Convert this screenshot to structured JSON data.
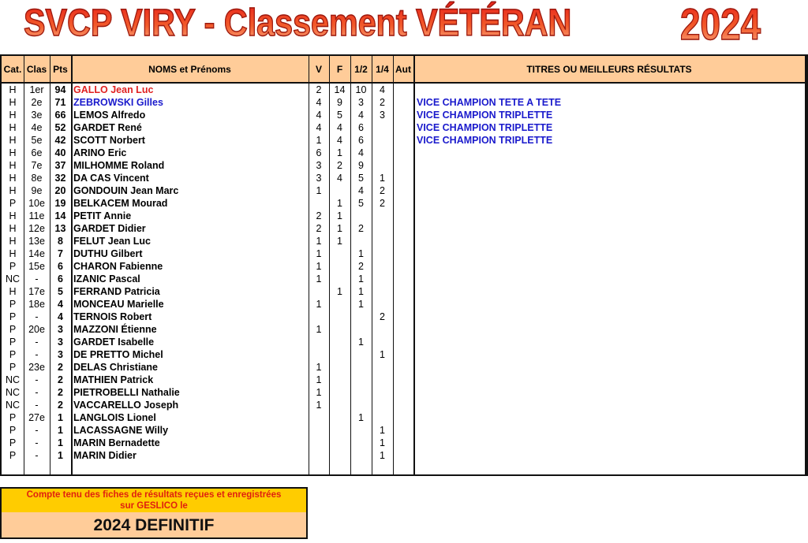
{
  "title": {
    "main": "SVCP VIRY - Classement VÉTÉRAN",
    "year": "2024"
  },
  "colors": {
    "header_bg": "#ffcc99",
    "first_name_color": "#e02020",
    "second_name_color": "#1a1acc",
    "titre_color": "#1a1acc",
    "footer_top_bg": "#ffcc00",
    "footer_text_red": "#e02010"
  },
  "table": {
    "headers": {
      "cat": "Cat.",
      "clas": "Clas",
      "pts": "Pts",
      "name": "NOMS et Prénoms",
      "v": "V",
      "f": "F",
      "half": "1/2",
      "quarter": "1/4",
      "aut": "Aut",
      "titres": "TITRES OU MEILLEURS RÉSULTATS"
    },
    "rows": [
      {
        "cat": "H",
        "clas": "1er",
        "pts": "94",
        "name": "GALLO Jean Luc",
        "v": "2",
        "f": "14",
        "half": "10",
        "quarter": "4",
        "aut": "",
        "titre": ""
      },
      {
        "cat": "H",
        "clas": "2e",
        "pts": "71",
        "name": "ZEBROWSKI Gilles",
        "v": "4",
        "f": "9",
        "half": "3",
        "quarter": "2",
        "aut": "",
        "titre": "VICE CHAMPION TETE A TETE"
      },
      {
        "cat": "H",
        "clas": "3e",
        "pts": "66",
        "name": "LEMOS Alfredo",
        "v": "4",
        "f": "5",
        "half": "4",
        "quarter": "3",
        "aut": "",
        "titre": "VICE CHAMPION TRIPLETTE"
      },
      {
        "cat": "H",
        "clas": "4e",
        "pts": "52",
        "name": "GARDET René",
        "v": "4",
        "f": "4",
        "half": "6",
        "quarter": "",
        "aut": "",
        "titre": "VICE CHAMPION TRIPLETTE"
      },
      {
        "cat": "H",
        "clas": "5e",
        "pts": "42",
        "name": "SCOTT Norbert",
        "v": "1",
        "f": "4",
        "half": "6",
        "quarter": "",
        "aut": "",
        "titre": "VICE CHAMPION TRIPLETTE"
      },
      {
        "cat": "H",
        "clas": "6e",
        "pts": "40",
        "name": "ARINO Eric",
        "v": "6",
        "f": "1",
        "half": "4",
        "quarter": "",
        "aut": "",
        "titre": ""
      },
      {
        "cat": "H",
        "clas": "7e",
        "pts": "37",
        "name": "MILHOMME Roland",
        "v": "3",
        "f": "2",
        "half": "9",
        "quarter": "",
        "aut": "",
        "titre": ""
      },
      {
        "cat": "H",
        "clas": "8e",
        "pts": "32",
        "name": "DA CAS Vincent",
        "v": "3",
        "f": "4",
        "half": "5",
        "quarter": "1",
        "aut": "",
        "titre": ""
      },
      {
        "cat": "H",
        "clas": "9e",
        "pts": "20",
        "name": "GONDOUIN Jean Marc",
        "v": "1",
        "f": "",
        "half": "4",
        "quarter": "2",
        "aut": "",
        "titre": ""
      },
      {
        "cat": "P",
        "clas": "10e",
        "pts": "19",
        "name": "BELKACEM Mourad",
        "v": "",
        "f": "1",
        "half": "5",
        "quarter": "2",
        "aut": "",
        "titre": ""
      },
      {
        "cat": "H",
        "clas": "11e",
        "pts": "14",
        "name": "PETIT Annie",
        "v": "2",
        "f": "1",
        "half": "",
        "quarter": "",
        "aut": "",
        "titre": ""
      },
      {
        "cat": "H",
        "clas": "12e",
        "pts": "13",
        "name": "GARDET Didier",
        "v": "2",
        "f": "1",
        "half": "2",
        "quarter": "",
        "aut": "",
        "titre": ""
      },
      {
        "cat": "H",
        "clas": "13e",
        "pts": "8",
        "name": "FELUT Jean Luc",
        "v": "1",
        "f": "1",
        "half": "",
        "quarter": "",
        "aut": "",
        "titre": ""
      },
      {
        "cat": "H",
        "clas": "14e",
        "pts": "7",
        "name": "DUTHU Gilbert",
        "v": "1",
        "f": "",
        "half": "1",
        "quarter": "",
        "aut": "",
        "titre": ""
      },
      {
        "cat": "P",
        "clas": "15e",
        "pts": "6",
        "name": "CHARON Fabienne",
        "v": "1",
        "f": "",
        "half": "2",
        "quarter": "",
        "aut": "",
        "titre": ""
      },
      {
        "cat": "NC",
        "clas": "-",
        "pts": "6",
        "name": "IZANIC Pascal",
        "v": "1",
        "f": "",
        "half": "1",
        "quarter": "",
        "aut": "",
        "titre": ""
      },
      {
        "cat": "H",
        "clas": "17e",
        "pts": "5",
        "name": "FERRAND Patricia",
        "v": "",
        "f": "1",
        "half": "1",
        "quarter": "",
        "aut": "",
        "titre": ""
      },
      {
        "cat": "P",
        "clas": "18e",
        "pts": "4",
        "name": "MONCEAU Marielle",
        "v": "1",
        "f": "",
        "half": "1",
        "quarter": "",
        "aut": "",
        "titre": ""
      },
      {
        "cat": "P",
        "clas": "-",
        "pts": "4",
        "name": "TERNOIS Robert",
        "v": "",
        "f": "",
        "half": "",
        "quarter": "2",
        "aut": "",
        "titre": ""
      },
      {
        "cat": "P",
        "clas": "20e",
        "pts": "3",
        "name": "MAZZONI Étienne",
        "v": "1",
        "f": "",
        "half": "",
        "quarter": "",
        "aut": "",
        "titre": ""
      },
      {
        "cat": "P",
        "clas": "-",
        "pts": "3",
        "name": "GARDET Isabelle",
        "v": "",
        "f": "",
        "half": "1",
        "quarter": "",
        "aut": "",
        "titre": ""
      },
      {
        "cat": "P",
        "clas": "-",
        "pts": "3",
        "name": "DE PRETTO Michel",
        "v": "",
        "f": "",
        "half": "",
        "quarter": "1",
        "aut": "",
        "titre": ""
      },
      {
        "cat": "P",
        "clas": "23e",
        "pts": "2",
        "name": "DELAS Christiane",
        "v": "1",
        "f": "",
        "half": "",
        "quarter": "",
        "aut": "",
        "titre": ""
      },
      {
        "cat": "NC",
        "clas": "-",
        "pts": "2",
        "name": "MATHIEN Patrick",
        "v": "1",
        "f": "",
        "half": "",
        "quarter": "",
        "aut": "",
        "titre": ""
      },
      {
        "cat": "NC",
        "clas": "-",
        "pts": "2",
        "name": "PIETROBELLI Nathalie",
        "v": "1",
        "f": "",
        "half": "",
        "quarter": "",
        "aut": "",
        "titre": ""
      },
      {
        "cat": "NC",
        "clas": "-",
        "pts": "2",
        "name": "VACCARELLO Joseph",
        "v": "1",
        "f": "",
        "half": "",
        "quarter": "",
        "aut": "",
        "titre": ""
      },
      {
        "cat": "P",
        "clas": "27e",
        "pts": "1",
        "name": "LANGLOIS Lionel",
        "v": "",
        "f": "",
        "half": "1",
        "quarter": "",
        "aut": "",
        "titre": ""
      },
      {
        "cat": "P",
        "clas": "-",
        "pts": "1",
        "name": "LACASSAGNE Willy",
        "v": "",
        "f": "",
        "half": "",
        "quarter": "1",
        "aut": "",
        "titre": ""
      },
      {
        "cat": "P",
        "clas": "-",
        "pts": "1",
        "name": "MARIN Bernadette",
        "v": "",
        "f": "",
        "half": "",
        "quarter": "1",
        "aut": "",
        "titre": ""
      },
      {
        "cat": "P",
        "clas": "-",
        "pts": "1",
        "name": "MARIN Didier",
        "v": "",
        "f": "",
        "half": "",
        "quarter": "1",
        "aut": "",
        "titre": ""
      }
    ]
  },
  "footer": {
    "note_line1": "Compte tenu des fiches de résultats reçues et enregistrées",
    "note_line2": "sur GESLICO le",
    "status": "2024 DEFINITIF"
  }
}
